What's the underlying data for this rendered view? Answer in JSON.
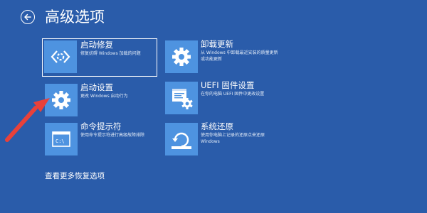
{
  "page": {
    "title": "高级选项"
  },
  "options": [
    {
      "title": "启动修复",
      "desc": "修复妨碍 Windows 加载的问题",
      "icon": "startup-repair-icon"
    },
    {
      "title": "启动设置",
      "desc": "更改 Windows 启动行为",
      "icon": "gear-icon"
    },
    {
      "title": "命令提示符",
      "desc": "使用命令提示符进行高级故障排除",
      "icon": "command-prompt-icon"
    },
    {
      "title": "卸载更新",
      "desc": "从 Windows 中卸载最近安装的质量更新或功能更新",
      "icon": "gear-icon"
    },
    {
      "title": "UEFI 固件设置",
      "desc": "在你的电脑 UEFI 固件中更改设置",
      "icon": "uefi-firmware-icon"
    },
    {
      "title": "系统还原",
      "desc": "使用你电脑上记录的还原点来还原 Windows",
      "icon": "system-restore-icon"
    }
  ],
  "more_options_link": "查看更多恢复选项",
  "colors": {
    "background": "#2a5caa",
    "tile": "#4e93e0",
    "annotation": "#e8413a"
  }
}
